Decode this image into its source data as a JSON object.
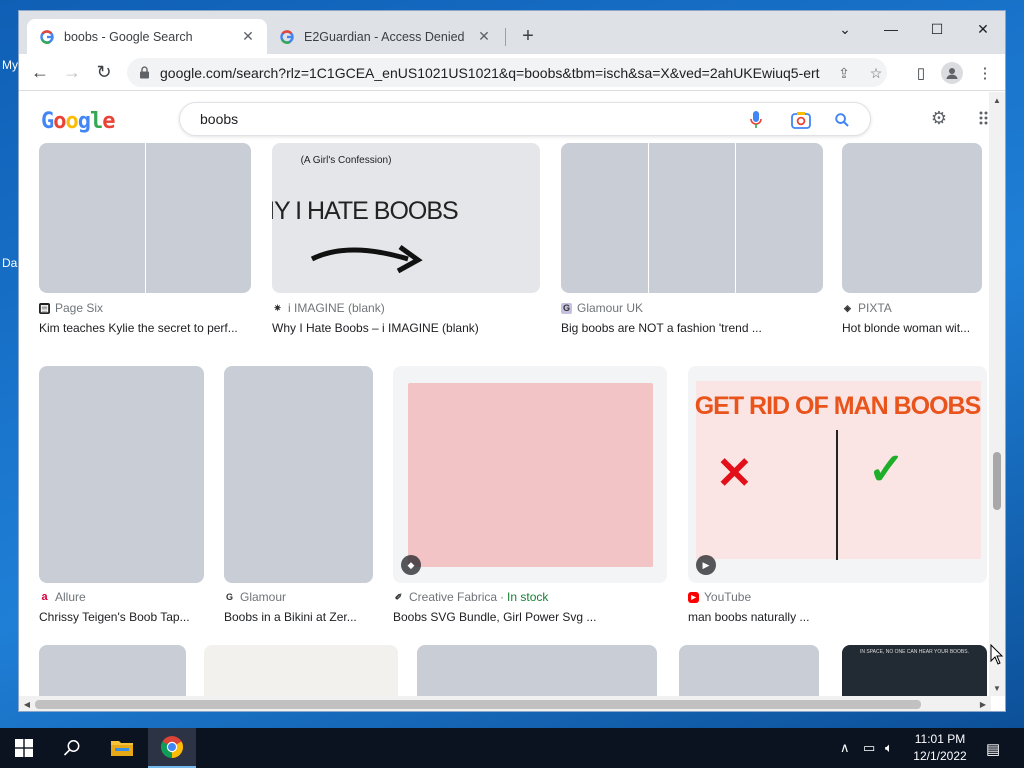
{
  "desktop": {
    "label_1": "My",
    "label_2": "Da"
  },
  "browser": {
    "tabs": [
      {
        "title": "boobs - Google Search",
        "active": true
      },
      {
        "title": "E2Guardian - Access Denied",
        "active": false
      }
    ],
    "url": "google.com/search?rlz=1C1GCEA_enUS1021US1021&q=boobs&tbm=isch&sa=X&ved=2ahUKEwiuq5-ertr..."
  },
  "search": {
    "query": "boobs",
    "logo": "Google"
  },
  "results_row1": [
    {
      "source": "Page Six",
      "caption": "Kim teaches Kylie the secret to perf..."
    },
    {
      "source": "i IMAGINE (blank)",
      "caption": "Why I Hate Boobs – i IMAGINE (blank)",
      "image_text_1": "(A Girl's Confession)",
      "image_text_2": "WHY I HATE BOOBS"
    },
    {
      "source": "Glamour UK",
      "caption": "Big boobs are NOT a fashion 'trend ..."
    },
    {
      "source": "PIXTA",
      "caption": "Hot blonde woman wit..."
    }
  ],
  "results_row2": [
    {
      "source": "Allure",
      "caption": "Chrissy Teigen's Boob Tap..."
    },
    {
      "source": "Glamour",
      "caption": "Boobs in a Bikini at Zer..."
    },
    {
      "source": "Creative Fabrica",
      "availability": "In stock",
      "caption": "Boobs SVG Bundle, Girl Power Svg ..."
    },
    {
      "source": "YouTube",
      "caption": "man boobs naturally ...",
      "image_text": "GET RID OF MAN BOOBS"
    }
  ],
  "results_row3": [
    {
      "image_text": "IN SPACE, NO ONE CAN HEAR YOUR BOOBS."
    }
  ],
  "taskbar": {
    "time": "11:01 PM",
    "date": "12/1/2022"
  },
  "colors": {
    "accent": "#1a73e8",
    "in_stock": "#188038",
    "youtube_red": "#ff0000"
  }
}
